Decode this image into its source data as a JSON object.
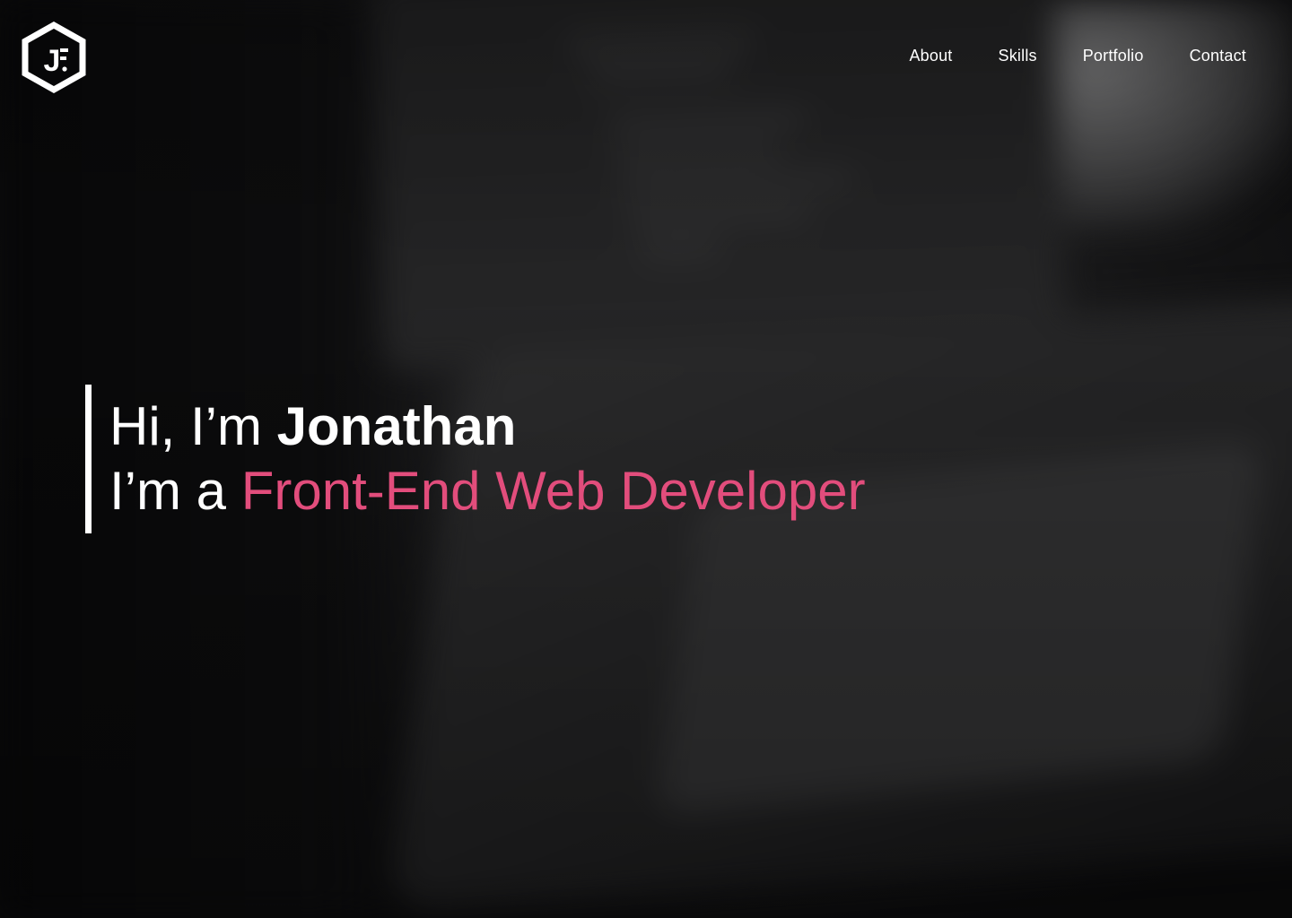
{
  "logo": {
    "icon": "hexagon-monogram-logo",
    "text": "J"
  },
  "nav": {
    "items": [
      {
        "label": "About"
      },
      {
        "label": "Skills"
      },
      {
        "label": "Portfolio"
      },
      {
        "label": "Contact"
      }
    ]
  },
  "intro": {
    "greeting": "Hi, I’m ",
    "name": "Jonathan",
    "role_prefix": "I’m a ",
    "role": "Front-End Web Developer"
  },
  "colors": {
    "accent": "#e24d7c",
    "text": "#ffffff",
    "background": "#0b0b0c"
  }
}
